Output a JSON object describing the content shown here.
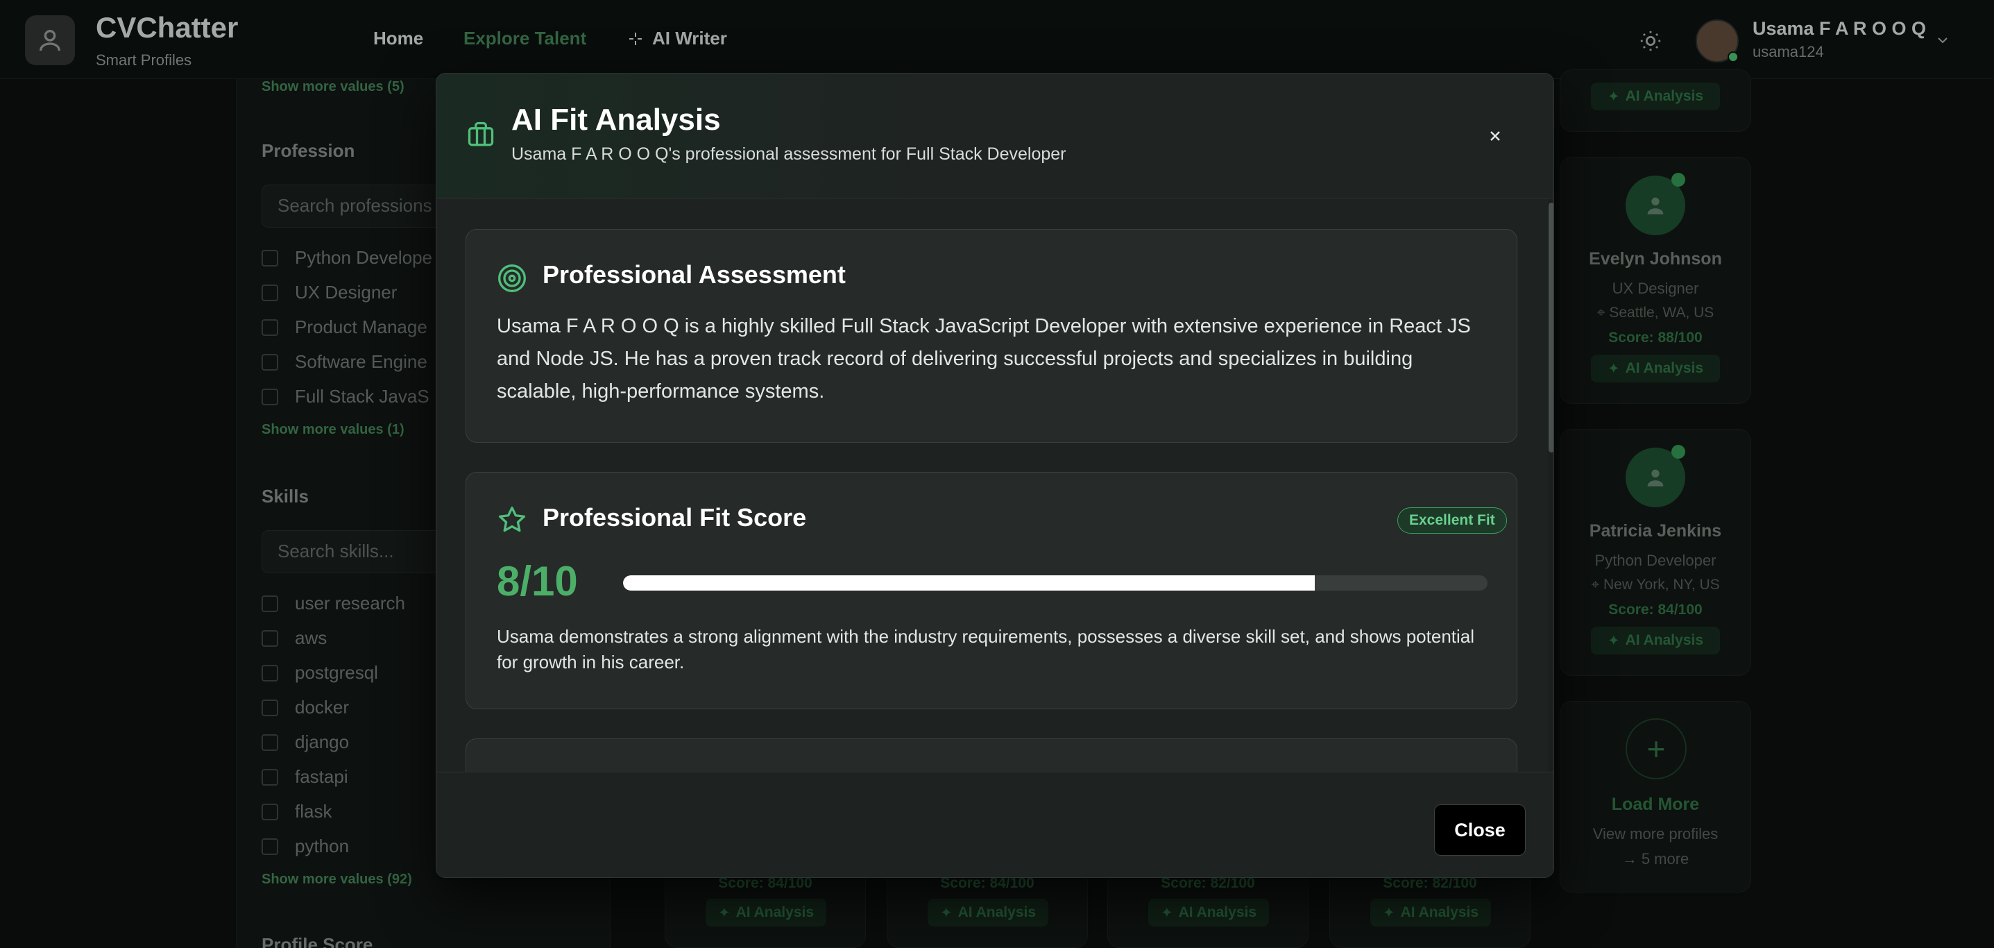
{
  "app": {
    "brand_title": "CVChatter",
    "brand_subtitle": "Smart Profiles",
    "nav": {
      "home": "Home",
      "explore": "Explore Talent",
      "ai_writer": "AI Writer"
    },
    "user": {
      "name": "Usama F A R O O Q",
      "handle": "usama124"
    }
  },
  "sidebar": {
    "show_more_top": "Show more values (5)",
    "profession": {
      "heading": "Profession",
      "placeholder": "Search professions",
      "options": [
        "Python Develope",
        "UX Designer",
        "Product Manage",
        "Software Engine",
        "Full Stack JavaS"
      ],
      "show_more": "Show more values (1)"
    },
    "skills": {
      "heading": "Skills",
      "placeholder": "Search skills...",
      "options": [
        "user research",
        "aws",
        "postgresql",
        "docker",
        "django",
        "fastapi",
        "flask",
        "python"
      ],
      "show_more": "Show more values (92)"
    },
    "profile_score_heading": "Profile Score"
  },
  "cards": {
    "ai_label": "AI Analysis",
    "evelyn": {
      "name": "Evelyn Johnson",
      "role": "UX Designer",
      "location": "Seattle, WA, US",
      "score": "Score: 88/100"
    },
    "patricia": {
      "name": "Patricia Jenkins",
      "role": "Python Developer",
      "location": "New York, NY, US",
      "score": "Score: 84/100"
    },
    "bottom_scores": [
      "Score: 84/100",
      "Score: 84/100",
      "Score: 82/100",
      "Score: 82/100"
    ],
    "load_more": {
      "title": "Load More",
      "subtitle": "View more profiles",
      "count": "→ 5 more"
    }
  },
  "modal": {
    "title": "AI Fit Analysis",
    "subtitle": "Usama F A R O O Q's professional assessment for Full Stack Developer",
    "assessment": {
      "title": "Professional Assessment",
      "text": "Usama F A R O O Q is a highly skilled Full Stack JavaScript Developer with extensive experience in React JS and Node JS. He has a proven track record of delivering successful projects and specializes in building scalable, high-performance systems."
    },
    "fit_score": {
      "title": "Professional Fit Score",
      "badge": "Excellent Fit",
      "score_text": "8/10",
      "score_fraction": 0.8,
      "text": "Usama demonstrates a strong alignment with the industry requirements, possesses a diverse skill set, and shows potential for growth in his career."
    },
    "close_label": "Close"
  },
  "colors": {
    "accent": "#4caf68",
    "badge_text": "#6ad08e",
    "background": "#0b0f0d",
    "modal_bg": "#1e2221"
  }
}
